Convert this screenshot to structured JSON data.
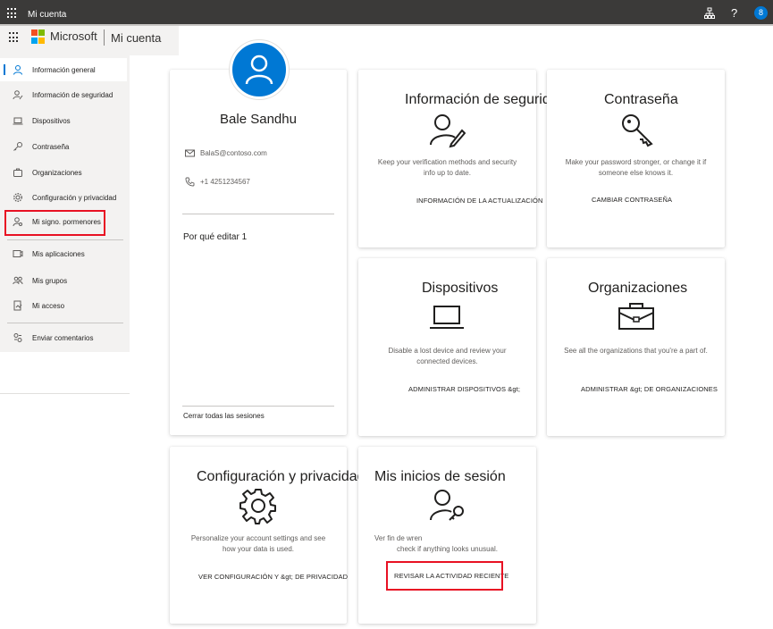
{
  "topbar": {
    "title": "Mi cuenta",
    "help": "?",
    "avatar_initial": "8"
  },
  "brand": {
    "name": "Microsoft",
    "app": "Mi cuenta",
    "logo_colors": [
      "#f25022",
      "#7fba00",
      "#00a4ef",
      "#ffb900"
    ]
  },
  "sidebar": {
    "items": [
      {
        "label": "Información general",
        "icon": "person-icon"
      },
      {
        "label": "Información de seguridad",
        "icon": "security-info-icon"
      },
      {
        "label": "Dispositivos",
        "icon": "laptop-icon"
      },
      {
        "label": "Contraseña",
        "icon": "key-icon"
      },
      {
        "label": "Organizaciones",
        "icon": "briefcase-icon"
      },
      {
        "label": "Configuración y privacidad",
        "icon": "gear-icon"
      },
      {
        "label": "Mi signo. pormenores",
        "icon": "sign-in-icon"
      },
      {
        "label": "Mis aplicaciones",
        "icon": "apps-icon"
      },
      {
        "label": "Mis grupos",
        "icon": "groups-icon"
      },
      {
        "label": "Mi acceso",
        "icon": "access-icon"
      },
      {
        "label": "Enviar comentarios",
        "icon": "feedback-icon"
      }
    ]
  },
  "profile": {
    "name": "Bale Sandhu",
    "email": "BalaS@contoso.com",
    "phone": "+1 4251234567",
    "why_edit": "Por qué editar 1",
    "sign_out_all": "Cerrar todas las sesiones"
  },
  "cards": {
    "security": {
      "title": "Información de seguridad",
      "desc1": "Keep your verification methods and security",
      "desc2": "info up to date.",
      "link": "INFORMACIÓN DE LA ACTUALIZACIÓN"
    },
    "password": {
      "title": "Contraseña",
      "desc1": "Make your password stronger, or change it if",
      "desc2": "someone else knows it.",
      "link": "CAMBIAR CONTRASEÑA"
    },
    "devices": {
      "title": "Dispositivos",
      "desc1": "Disable a lost device and review your",
      "desc2": "connected devices.",
      "link": "ADMINISTRAR DISPOSITIVOS &gt;"
    },
    "organizations": {
      "title": "Organizaciones",
      "desc1": "See all the organizations that you're a part of.",
      "link": "ADMINISTRAR &gt; DE ORGANIZACIONES"
    },
    "settings": {
      "title": "Configuración y privacidad",
      "desc1": "Personalize your account settings and see",
      "desc2": "how your data is used.",
      "link": "VER CONFIGURACIÓN Y &gt; DE PRIVACIDAD"
    },
    "signins": {
      "title": "Mis inicios de sesión",
      "desc1": "Ver fin de wren",
      "desc2": "check if anything looks unusual.",
      "link": "REVISAR LA ACTIVIDAD RECIENTE"
    }
  },
  "colors": {
    "accent": "#0078d4",
    "highlight": "#e81123",
    "topbar": "#3b3a39"
  }
}
